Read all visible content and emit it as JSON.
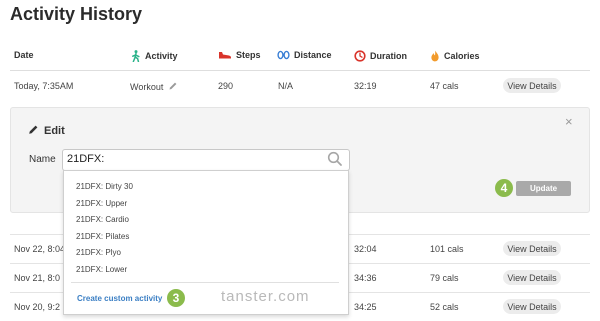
{
  "page": {
    "title": "Activity History"
  },
  "columns": {
    "date": "Date",
    "activity": "Activity",
    "steps": "Steps",
    "distance": "Distance",
    "duration": "Duration",
    "calories": "Calories"
  },
  "icons": {
    "activity": "walking-figure-icon",
    "steps": "shoe-icon",
    "distance": "footprints-icon",
    "duration": "clock-icon",
    "calories": "flame-icon",
    "edit": "pencil-icon",
    "search": "magnifier-icon",
    "close": "close-icon"
  },
  "colors": {
    "activity_icon": "#2bb38a",
    "steps_icon": "#d9342b",
    "distance_icon": "#3a7fd5",
    "duration_icon": "#d9342b",
    "calories_icon": "#f29b2c",
    "badge": "#8bbb4c",
    "link": "#3b7fc4",
    "update_button": "#a9a9a9"
  },
  "rows": [
    {
      "date": "Today, 7:35AM",
      "activity": "Workout",
      "steps": "290",
      "distance": "N/A",
      "duration": "32:19",
      "calories": "47 cals",
      "details": "View Details"
    },
    {
      "date": "Nov 22, 8:04",
      "duration": "32:04",
      "calories": "101 cals",
      "details": "View Details"
    },
    {
      "date": "Nov 21, 8:0",
      "duration": "34:36",
      "calories": "79 cals",
      "details": "View Details"
    },
    {
      "date": "Nov 20, 9:2",
      "duration": "34:25",
      "calories": "52 cals",
      "details": "View Details"
    }
  ],
  "edit": {
    "title": "Edit",
    "close": "×",
    "name_label": "Name",
    "name_value": "21DFX:",
    "update_label": "Update"
  },
  "dropdown": {
    "options": [
      "21DFX: Dirty 30",
      "21DFX: Upper",
      "21DFX: Cardio",
      "21DFX: Pilates",
      "21DFX: Plyo",
      "21DFX: Lower"
    ],
    "create_label": "Create custom activity"
  },
  "badges": {
    "update_step": "4",
    "create_step": "3"
  },
  "watermark": "tanster.com"
}
